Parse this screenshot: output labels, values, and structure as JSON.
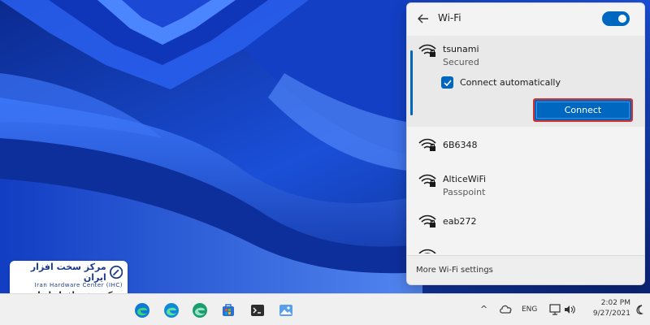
{
  "flyout": {
    "title": "Wi-Fi",
    "toggle_on": true,
    "networks": [
      {
        "name": "tsunami",
        "status": "Secured",
        "selected": true
      },
      {
        "name": "6B6348",
        "status": ""
      },
      {
        "name": "AlticeWiFi",
        "status": "Passpoint"
      },
      {
        "name": "eab272",
        "status": ""
      },
      {
        "name": "",
        "status": ""
      }
    ],
    "auto_connect_label": "Connect automatically",
    "auto_connect_checked": true,
    "connect_label": "Connect",
    "more_settings_label": "More Wi-Fi settings"
  },
  "taskbar": {
    "apps": [
      "edge-icon",
      "edge-beta-icon",
      "edge-dev-icon",
      "store-icon",
      "terminal-icon",
      "photos-icon"
    ],
    "tray": {
      "chevron": "^",
      "language": "ENG",
      "time": "2:02 PM",
      "date": "9/27/2021"
    }
  },
  "logo": {
    "fa_title": "مرکز سخت افزار ایران",
    "en_title": "Iran Hardware Center (IHC)",
    "fa_sub": "مرکز سخت افزار ایران"
  },
  "colors": {
    "accent": "#0067c0",
    "highlight_border": "#d32f2f"
  }
}
